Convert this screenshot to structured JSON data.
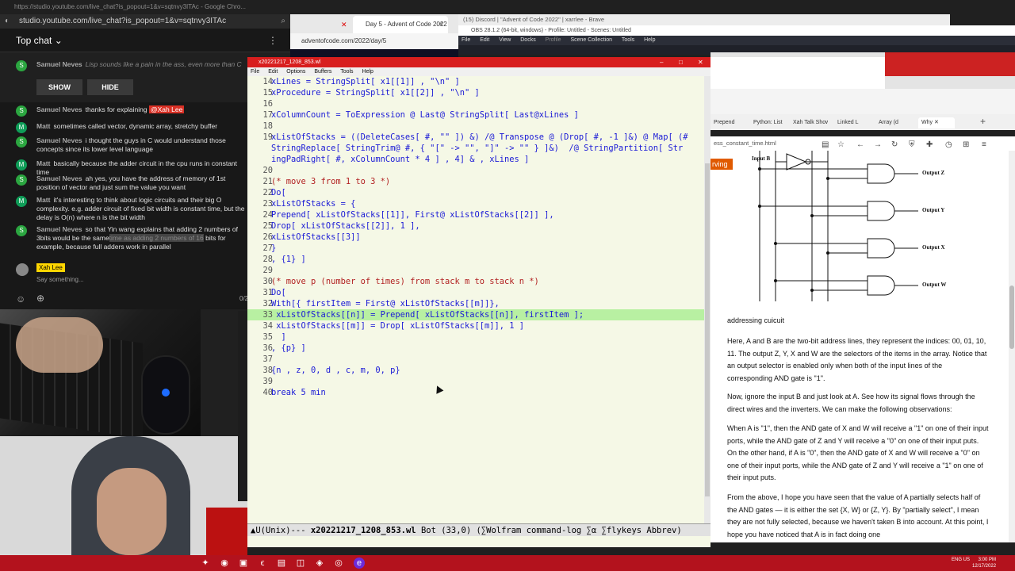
{
  "youtube": {
    "window_title": "https://studio.youtube.com/live_chat?is_popout=1&v=sqtnvy3ITAc - Google Chro...",
    "url": "studio.youtube.com/live_chat?is_popout=1&v=sqtnvy3ITAc",
    "chat_header": "Top chat",
    "more_icon": "⋮",
    "pinned": {
      "name": "Samuel Neves",
      "text": "Lisp sounds like a pain in the ass, even more than C",
      "show": "SHOW",
      "hide": "HIDE",
      "avatar": "S"
    },
    "messages": [
      {
        "avatar": "S",
        "name": "Samuel Neves",
        "text": "thanks for explaining",
        "mention": "@Xah Lee"
      },
      {
        "avatar": "M",
        "name": "Matt",
        "text": "sometimes called vector, dynamic array, stretchy buffer"
      },
      {
        "avatar": "S",
        "name": "Samuel Neves",
        "text": "i thought the guys in C would understand those concepts since its lower level language"
      },
      {
        "avatar": "M",
        "name": "Matt",
        "text": "basically because the adder circuit in the cpu runs in constant time"
      },
      {
        "avatar": "S",
        "name": "Samuel Neves",
        "text": "ah yes, you have the address of memory of 1st position of vector and just sum the value you want"
      },
      {
        "avatar": "M",
        "name": "Matt",
        "text": "it's interesting to think about logic circuits and their big O complexity. e.g. adder circuit of fixed bit width is constant time, but the delay is O(n) where n is the bit width"
      },
      {
        "avatar": "S",
        "name": "Samuel Neves",
        "text_before": "so that Yin wang explains that adding 2 numbers of 3bits would be the same",
        "text_hl": "time as adding 2 numbers of 16",
        "text_after": "bits for example, because full adders work in parallel"
      }
    ],
    "input": {
      "owner": "Xah Lee",
      "placeholder": "Say something...",
      "count": "0/2",
      "emoji": "☺",
      "money": "⊕"
    },
    "colors": {
      "avatar_s": "#2ba640",
      "avatar_m": "#0f9d58"
    }
  },
  "aoc": {
    "tab": "Day 5 - Advent of Code 2022",
    "url": "adventofcode.com/2022/day/5"
  },
  "discord": {
    "title": "(15) Discord | \"Advent of Code 2022\" | xarrlee - Brave"
  },
  "obs": {
    "title": "OBS 28.1.2 (64-bit, windows) - Profile: Untitled - Scenes: Untitled",
    "menu": [
      "File",
      "Edit",
      "View",
      "Docks",
      "Profile",
      "Scene Collection",
      "Tools",
      "Help"
    ]
  },
  "emacs": {
    "title": "x20221217_1208_853.wl",
    "menu": [
      "File",
      "Edit",
      "Options",
      "Buffers",
      "Tools",
      "Help"
    ],
    "lines": [
      {
        "n": "14",
        "t": "xLines = StringSplit[ x1[[1]] , \"\\n\" ]"
      },
      {
        "n": "15",
        "t": "xProcedure = StringSplit[ x1[[2]] , \"\\n\" ]"
      },
      {
        "n": "16",
        "t": ""
      },
      {
        "n": "17",
        "t": "xColumnCount = ToExpression @ Last@ StringSplit[ Last@xLines ]"
      },
      {
        "n": "18",
        "t": ""
      },
      {
        "n": "19",
        "t": "xListOfStacks = ((DeleteCases[ #, \"\" ]) &) /@ Transpose @ (Drop[ #, -1 ]&) @ Map[ (#"
      },
      {
        "n": "",
        "t": "StringReplace[ StringTrim@ #, { \"[\" -> \"\", \"]\" -> \"\" } ]&)  /@ StringPartition[ Str"
      },
      {
        "n": "",
        "t": "ingPadRight[ #, xColumnCount * 4 ] , 4] & , xLines ]"
      },
      {
        "n": "20",
        "t": ""
      },
      {
        "n": "21",
        "t": "(* move 3 from 1 to 3 *)"
      },
      {
        "n": "22",
        "t": "Do["
      },
      {
        "n": "23",
        "t": "xListOfStacks = {"
      },
      {
        "n": "24",
        "t": "Prepend[ xListOfStacks[[1]], First@ xListOfStacks[[2]] ],"
      },
      {
        "n": "25",
        "t": "Drop[ xListOfStacks[[2]], 1 ],"
      },
      {
        "n": "26",
        "t": "xListOfStacks[[3]]"
      },
      {
        "n": "27",
        "t": "}"
      },
      {
        "n": "28",
        "t": ", {1} ]"
      },
      {
        "n": "29",
        "t": ""
      },
      {
        "n": "30",
        "t": "(* move p (number of times) from stack m to stack n *)"
      },
      {
        "n": "31",
        "t": "Do["
      },
      {
        "n": "32",
        "t": "With[{ firstItem = First@ xListOfStacks[[m]]},"
      },
      {
        "n": "33",
        "t": " xListOfStacks[[n]] = Prepend[ xListOfStacks[[n]], firstItem ];",
        "current": true
      },
      {
        "n": "34",
        "t": " xListOfStacks[[m]] = Drop[ xListOfStacks[[m]], 1 ]"
      },
      {
        "n": "35",
        "t": "  ]"
      },
      {
        "n": "36",
        "t": ", {p} ]"
      },
      {
        "n": "37",
        "t": ""
      },
      {
        "n": "38",
        "t": "{n , z, 0, d , c, m, 0, p}"
      },
      {
        "n": "39",
        "t": ""
      },
      {
        "n": "40",
        "t": "break 5 min"
      }
    ],
    "modeline": {
      "prefix": "▲U(Unix)--- ",
      "buffer": "x20221217_1208_853.wl",
      "rest": " Bot (33,0) (∑Wolfram command-log ∑α ∑flykeys Abbrev)"
    },
    "colors": {
      "keyword": "#1a1ad6",
      "symbol": "#8b6b00",
      "comment": "#b22222",
      "string": "#2f7f2f",
      "current_line": "#b8f0a2"
    }
  },
  "right_browser": {
    "tabs": [
      "Prepend",
      "Python: List",
      "Xah Talk Show",
      "Linked L",
      "Array (d",
      "Why"
    ],
    "url": "ess_constant_time.html",
    "serving_badge": "rving",
    "diagram": {
      "input_label": "Input B",
      "outputs": [
        "Output Z",
        "Output Y",
        "Output X",
        "Output W"
      ]
    },
    "article": [
      "addressing cuicuit",
      "Here, A and B are the two-bit address lines, they represent the indices: 00, 01, 10, 11. The output Z, Y, X and W are the selectors of the items in the array. Notice that an output selector is enabled only when both of the input lines of the corresponding AND gate is \"1\".",
      "Now, ignore the input B and just look at A. See how its signal flows through the direct wires and the inverters. We can make the following observations:",
      "When A is \"1\", then the AND gate of X and W will receive a \"1\" on one of their input ports, while the AND gate of Z and Y will receive a \"0\" on one of their input puts. On the other hand, if A is \"0\", then the AND gate of X and W will receive a \"0\" on one of their input ports, while the AND gate of Z and Y will receive a \"1\" on one of their input puts.",
      "From the above, I hope you have seen that the value of A partially selects half of the AND gates — it is either the set {X, W} or {Z, Y}. By \"partially select\", I mean they are not fully selected, because we haven't taken B into account. At this point, I hope you have noticed that A is in fact doing one"
    ]
  },
  "taskbar": {
    "clock_time": "3:00 PM",
    "clock_date": "12/17/2022",
    "tray": "ENG US"
  }
}
